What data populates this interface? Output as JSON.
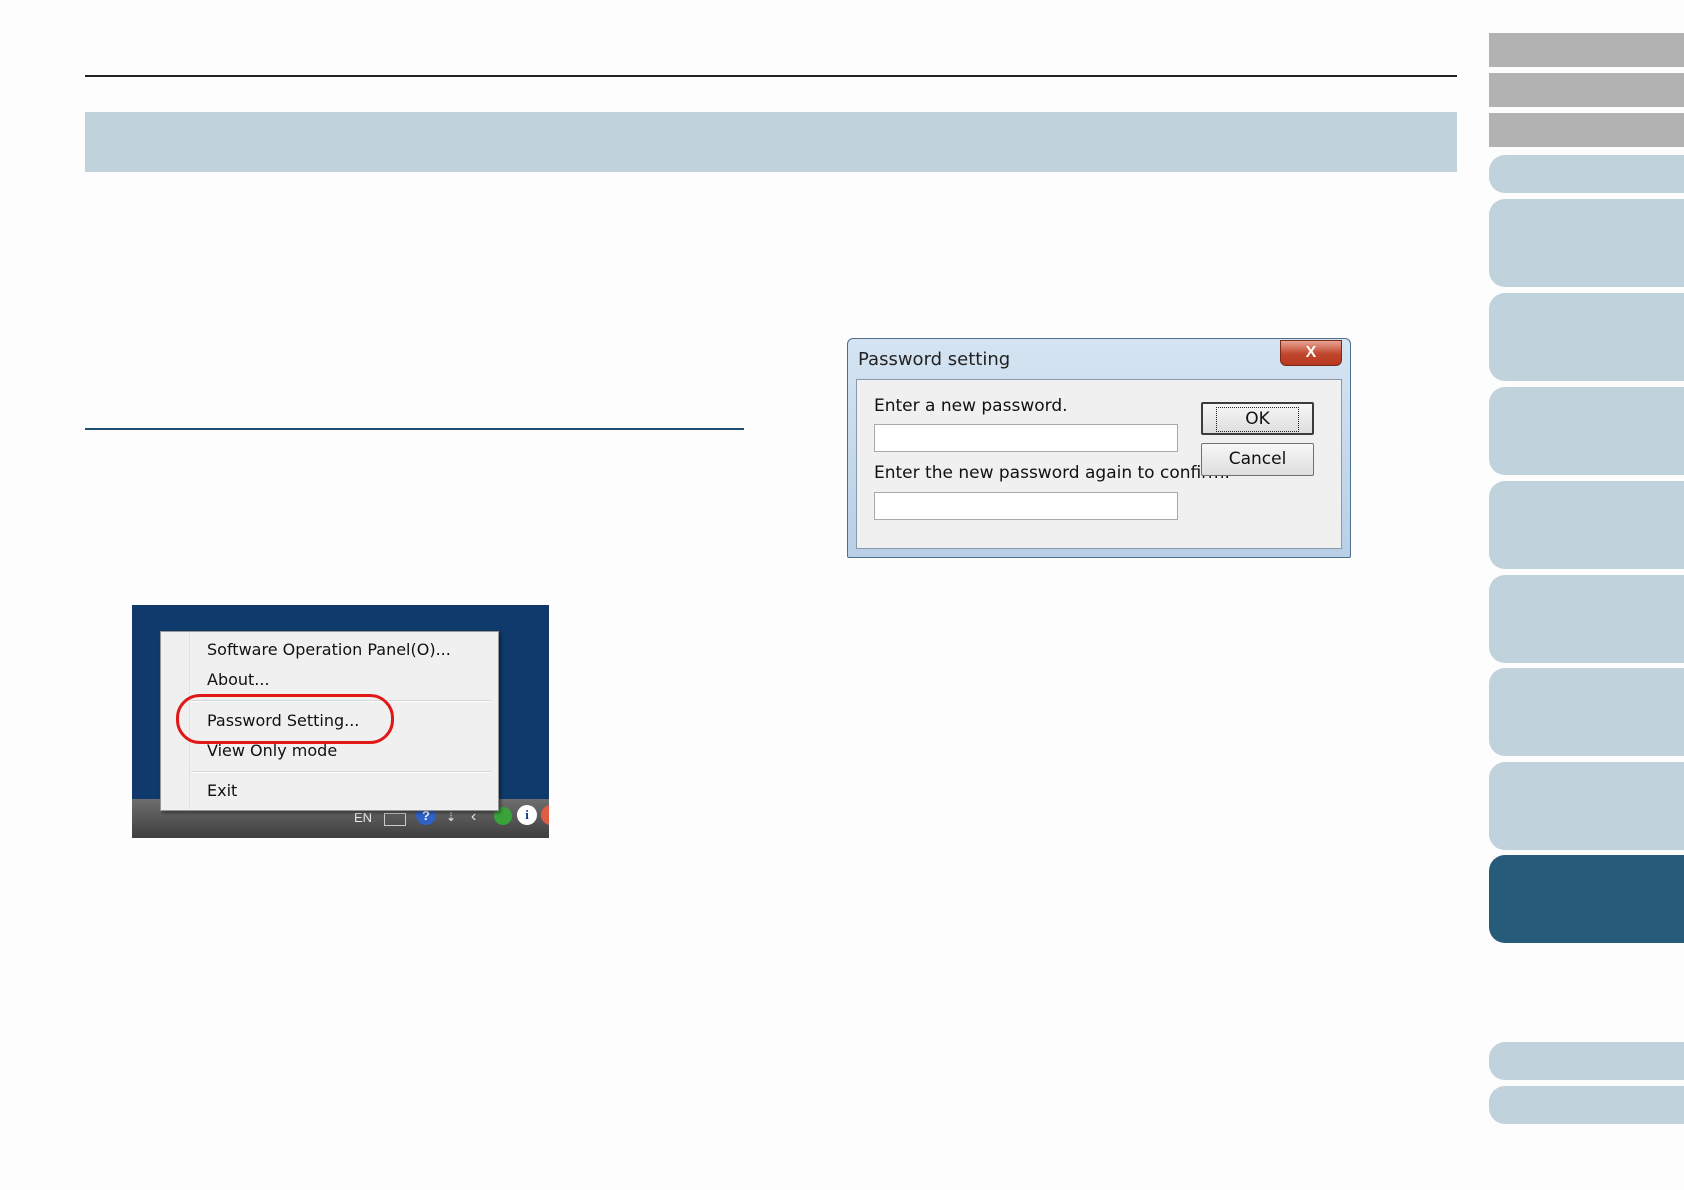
{
  "context_menu": {
    "items": [
      {
        "label": "Software Operation Panel(O)..."
      },
      {
        "label": "About..."
      },
      {
        "label": "Password Setting..."
      },
      {
        "label": "View Only mode"
      },
      {
        "label": "Exit"
      }
    ],
    "highlighted_item": "Password Setting...",
    "highlight_color": "#e01818"
  },
  "taskbar": {
    "language": "EN",
    "tray_icons": [
      "keyboard-icon",
      "help-icon",
      "arrow-icon",
      "chevron-icon",
      "scanner-icon",
      "info-icon",
      "red-app-icon"
    ]
  },
  "password_dialog": {
    "title": "Password setting",
    "close_label": "X",
    "new_password_label": "Enter a new password.",
    "confirm_password_label": "Enter the new password again to confirm.",
    "new_password_value": "",
    "confirm_password_value": "",
    "ok_label": "OK",
    "cancel_label": "Cancel"
  },
  "colors": {
    "title_band": "#c0d2dc",
    "nav_tab_light": "#c0d2dc",
    "nav_tab_active": "#275b7a",
    "nav_tab_gray": "#b2b2b2",
    "desktop_background": "#0f3a6b"
  }
}
